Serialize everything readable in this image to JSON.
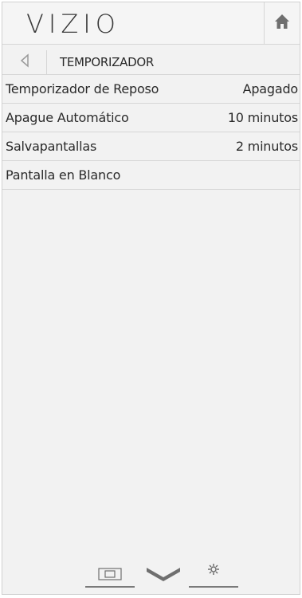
{
  "header": {
    "logo": "VIZIO",
    "home_icon": "home-icon"
  },
  "breadcrumb": {
    "back_icon": "back-arrow-icon",
    "title": "TEMPORIZADOR"
  },
  "menu": {
    "items": [
      {
        "label": "Temporizador de Reposo",
        "value": "Apagado"
      },
      {
        "label": "Apague Automático",
        "value": "10 minutos"
      },
      {
        "label": "Salvapantallas",
        "value": "2 minutos"
      },
      {
        "label": "Pantalla en Blanco",
        "value": ""
      }
    ]
  },
  "bottom_nav": {
    "tabs": [
      {
        "icon": "picture-icon"
      },
      {
        "icon": "vizio-v-icon"
      },
      {
        "icon": "gear-icon"
      }
    ]
  },
  "colors": {
    "background": "#f2f2f2",
    "divider": "#d6d6d6",
    "text": "#2a2a2a",
    "icon": "#6f6f6f"
  }
}
